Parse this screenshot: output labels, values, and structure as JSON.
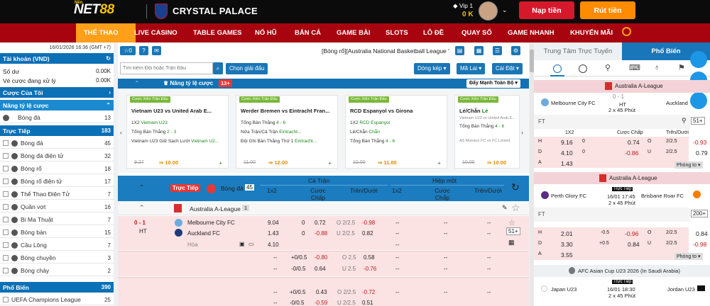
{
  "header": {
    "logo_prefix": "NET",
    "logo_suffix": "88",
    "logo_tag": "Nền",
    "club": "CRYSTAL PALACE",
    "vip": "Vip 1",
    "balance": "0 K",
    "deposit": "Nạp tiền",
    "withdraw": "Rút tiền"
  },
  "nav": [
    "THỂ THAO",
    "LIVE CASINO",
    "TABLE GAMES",
    "NỔ HŨ",
    "BẮN CÁ",
    "GAME BÀI",
    "SLOTS",
    "LÔ ĐỀ",
    "QUAY SỐ",
    "GAME NHANH",
    "KHUYẾN MÃI"
  ],
  "sidebar": {
    "datetime": "16/01/2026 16:36 (GMT +7)",
    "account": "Tài khoản (VND)",
    "balance_label": "Số dư",
    "balance_val": "0.00K",
    "pending_label": "Vé cược đang xử lý",
    "pending_val": "0.00K",
    "my_bets": "Cược Của Tôi",
    "boost": "Nâng tỷ lệ cược",
    "boost_items": [
      {
        "label": "Bóng đá",
        "count": "13"
      }
    ],
    "live": "Trực Tiếp",
    "live_count": "183",
    "live_items": [
      {
        "label": "Bóng đá",
        "count": "45"
      },
      {
        "label": "Bóng đá điện tử",
        "count": "32"
      },
      {
        "label": "Bóng rổ",
        "count": "18"
      },
      {
        "label": "Bóng rổ điện tử",
        "count": "17"
      },
      {
        "label": "Thể Thao Điện Tử",
        "count": "7"
      },
      {
        "label": "Quần vợt",
        "count": "16"
      },
      {
        "label": "Bi Ma Thuật",
        "count": "7"
      },
      {
        "label": "Bóng bàn",
        "count": "15"
      },
      {
        "label": "Cầu Lông",
        "count": "7"
      },
      {
        "label": "Bóng chuyền",
        "count": "3"
      },
      {
        "label": "Bóng chày",
        "count": "2"
      }
    ],
    "popular": "Phổ Biến",
    "popular_count": "390",
    "popular_items": [
      {
        "label": "UEFA Champions League",
        "count": "25"
      }
    ]
  },
  "toolbar": {
    "ticker": "[Bóng rổ][Australia National Basketball League '",
    "search_ph": "Tìm kiếm Đội hoặc Trận Đấu",
    "select_league": "Chọn giải đấu",
    "odds_type": "Dòng kép",
    "odds_format": "Mã Lai",
    "settings": "Cài Đặt"
  },
  "boost": {
    "title": "Nâng tỷ lệ cược",
    "badge": "13+",
    "btn": "Đẩy Mạnh Toàn Bộ"
  },
  "cards": [
    {
      "tag": "Cược Xiên Trận Đấu",
      "home": "Vietnam U23",
      "away": "United Arab E...",
      "l1a": "1X2 ",
      "l1b": "Vietnam U23",
      "l2a": "Tổng Bàn Thắng ",
      "l2b": "2 - 3",
      "l3a": "Vietnam U23 Giữ Sạch Lưới ",
      "l3b": "Vietnam U2...",
      "old": "9.27",
      "new": "10.00"
    },
    {
      "tag": "Cược Xiên Trận Đấu",
      "home": "Werder Bremen",
      "away": "Eintracht Fran...",
      "l1a": "Tổng Bàn Thắng ",
      "l1b": "4 - 6",
      "l2a": "Nửa Trận/Cả Trận ",
      "l2b": "Eintracht...",
      "l3a": "Đội Ghi Bàn Thắng Thứ 1 ",
      "l3b": "Eintracht...",
      "old": "11.00",
      "new": "12.00"
    },
    {
      "tag": "Cược Xiên Trận Đấu",
      "home": "RCD Espanyol",
      "away": "Girona",
      "l1a": "1X2 ",
      "l1b": "RCD Espanyol",
      "l2a": "Lẻ/Chẵn ",
      "l2b": "Chẵn",
      "l3a": "Tổng Bàn Thắng ",
      "l3b": "4 - 6",
      "old": "10.00",
      "new": "11.00"
    },
    {
      "tag": "Cược Xiên Trận Đấu",
      "home": "Lẻ/Chẵn",
      "away": "Lẻ",
      "l1a": "Vietnam U23 vs United Arab E...",
      "l1b": "",
      "l2a": "Tổng Bàn Thắng ",
      "l2b": "4 - 6",
      "l3a": "AS Monaco FC vs FC Lorient",
      "l3b": "",
      "old": "10.00",
      "new": "10.00"
    }
  ],
  "table": {
    "live_badge": "Trực Tiếp",
    "sport": "Bóng đá",
    "count": "45",
    "full": "Cả Trận",
    "half": "Hiệp một",
    "c1": "1x2",
    "c2": "Cược Chấp",
    "c3": "Trên/Dưới",
    "league": "Australia A-League",
    "league_n": "1"
  },
  "match": {
    "score": "0 - 1",
    "state": "HT",
    "home": "Melbourne City FC",
    "away": "Auckland FC",
    "draw": "Hòa",
    "h1": "9.04",
    "h2": "0",
    "h3": "0.72",
    "h4": "O 2/2.5",
    "h5": "-0.98",
    "a1": "1.43",
    "a2": "0",
    "a3": "-0.88",
    "a4": "U 2/2.5",
    "a5": "0.82",
    "d1": "4.10",
    "more": "51+"
  },
  "alt": [
    {
      "hc": "+0/0.5",
      "ho": "-0.80",
      "hl": "O 2.5",
      "hv": "0.58",
      "ac": "-0/0.5",
      "ao": "0.64",
      "al": "U 2.5",
      "av": "-0.76"
    },
    {
      "hc": "+0/0.5",
      "ho": "0.43",
      "hl": "O 2/2.5",
      "hv": "-0.72",
      "ac": "-0/0.5",
      "ao": "-0.59",
      "al": "U 2/2.5",
      "av": "0.51"
    }
  ],
  "right": {
    "tab1": "Trung Tâm Trực Tuyến",
    "tab2": "Phổ Biến",
    "m1": {
      "league": "Australia A-League",
      "home": "Melbourne City FC",
      "away": "Auckland",
      "score": "0 - 1",
      "state": "HT",
      "time": "2 x 45 Phút",
      "ft": "FT",
      "more": "51+",
      "cols": [
        "1X2",
        "Cược Chấp",
        "Trên/Dưới"
      ],
      "rows": [
        [
          "H",
          "9.16",
          "0",
          "0.74",
          "O",
          "2/2.5",
          "-0.93"
        ],
        [
          "D",
          "4.10",
          "0",
          "-0.86",
          "U",
          "2/2.5",
          "0.79"
        ],
        [
          "A",
          "1.43",
          "",
          "",
          "",
          "",
          ""
        ]
      ],
      "expand": "Phóng to"
    },
    "m2": {
      "league": "Australia A-League",
      "live": "Trực Tiếp",
      "home": "Perth Glory FC",
      "away": "Brisbane Roar FC",
      "date": "16/01 17:45",
      "time": "2 x 45 Phút",
      "ft": "FT",
      "more": "200+",
      "rows": [
        [
          "H",
          "2.01",
          "-0.5",
          "-0.96",
          "O",
          "2/2.5",
          "0.84"
        ],
        [
          "D",
          "3.30",
          "+0.5",
          "0.84",
          "U",
          "2/2.5",
          "-0.98"
        ],
        [
          "A",
          "3.55",
          "",
          "",
          "",
          "",
          ""
        ]
      ],
      "expand": "Phóng to"
    },
    "m3": {
      "league": "AFC Asian Cup U23 2026 (In Saudi Arabia)",
      "live": "Trực Tiếp",
      "home": "Japan U23",
      "away": "Jordan U23",
      "date": "16/01 18:30",
      "time": "2 x 45 Phút"
    }
  }
}
